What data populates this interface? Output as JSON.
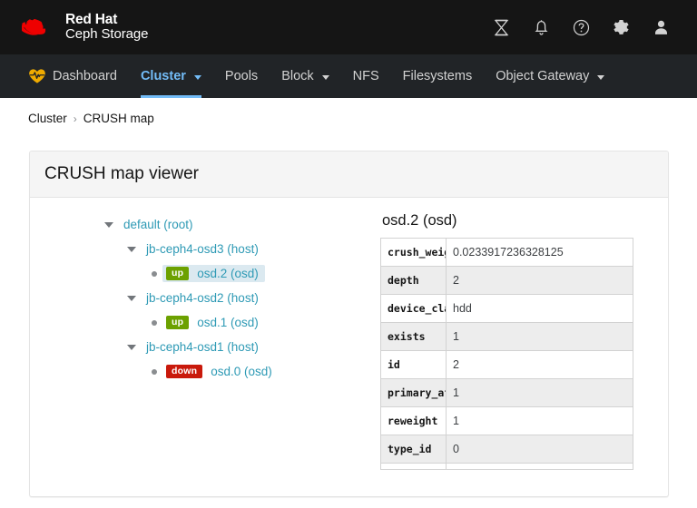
{
  "brand": {
    "line1": "Red Hat",
    "line2": "Ceph Storage",
    "logo_icon": "red-hat-fedora-icon"
  },
  "topbar": {
    "icons": [
      {
        "name": "tasks-hourglass-icon",
        "label": "Tasks"
      },
      {
        "name": "notifications-bell-icon",
        "label": "Notifications"
      },
      {
        "name": "help-circle-icon",
        "label": "Help"
      },
      {
        "name": "gear-icon",
        "label": "Settings"
      },
      {
        "name": "user-avatar-icon",
        "label": "User"
      }
    ]
  },
  "nav": {
    "items": [
      {
        "label": "Dashboard",
        "icon": "heartbeat-icon",
        "active": false,
        "dropdown": false
      },
      {
        "label": "Cluster",
        "active": true,
        "dropdown": true
      },
      {
        "label": "Pools",
        "active": false,
        "dropdown": false
      },
      {
        "label": "Block",
        "active": false,
        "dropdown": true
      },
      {
        "label": "NFS",
        "active": false,
        "dropdown": false
      },
      {
        "label": "Filesystems",
        "active": false,
        "dropdown": false
      },
      {
        "label": "Object Gateway",
        "active": false,
        "dropdown": true
      }
    ]
  },
  "breadcrumb": {
    "parent": "Cluster",
    "separator": "›",
    "current": "CRUSH map"
  },
  "card": {
    "title": "CRUSH map viewer"
  },
  "tree": {
    "nodes": [
      {
        "level": 0,
        "toggle": "triangle-down",
        "label": "default (root)",
        "badge": null,
        "selected": false
      },
      {
        "level": 1,
        "toggle": "triangle-down",
        "label": "jb-ceph4-osd3 (host)",
        "badge": null,
        "selected": false
      },
      {
        "level": 2,
        "toggle": "dot",
        "label": "osd.2 (osd)",
        "badge": "up",
        "badge_state": "up",
        "selected": true
      },
      {
        "level": 1,
        "toggle": "triangle-down",
        "label": "jb-ceph4-osd2 (host)",
        "badge": null,
        "selected": false
      },
      {
        "level": 2,
        "toggle": "dot",
        "label": "osd.1 (osd)",
        "badge": "up",
        "badge_state": "up",
        "selected": false
      },
      {
        "level": 1,
        "toggle": "triangle-down",
        "label": "jb-ceph4-osd1 (host)",
        "badge": null,
        "selected": false
      },
      {
        "level": 2,
        "toggle": "dot",
        "label": "osd.0 (osd)",
        "badge": "down",
        "badge_state": "down",
        "selected": false
      }
    ]
  },
  "detail": {
    "title": "osd.2 (osd)",
    "rows": [
      {
        "key": "crush_weight",
        "value": "0.0233917236328125"
      },
      {
        "key": "depth",
        "value": "2"
      },
      {
        "key": "device_class",
        "value": "hdd"
      },
      {
        "key": "exists",
        "value": "1"
      },
      {
        "key": "id",
        "value": "2"
      },
      {
        "key": "primary_affinity",
        "value": "1"
      },
      {
        "key": "reweight",
        "value": "1"
      },
      {
        "key": "type_id",
        "value": "0"
      }
    ]
  },
  "colors": {
    "topbar_bg": "#151515",
    "navbar_bg": "#212427",
    "active_nav": "#73bcf7",
    "brand_red": "#ee0000",
    "badge_up": "#6ca100",
    "badge_down": "#c9190b",
    "tree_link": "#2e9ab5",
    "selection_bg": "#dbe9f0"
  }
}
